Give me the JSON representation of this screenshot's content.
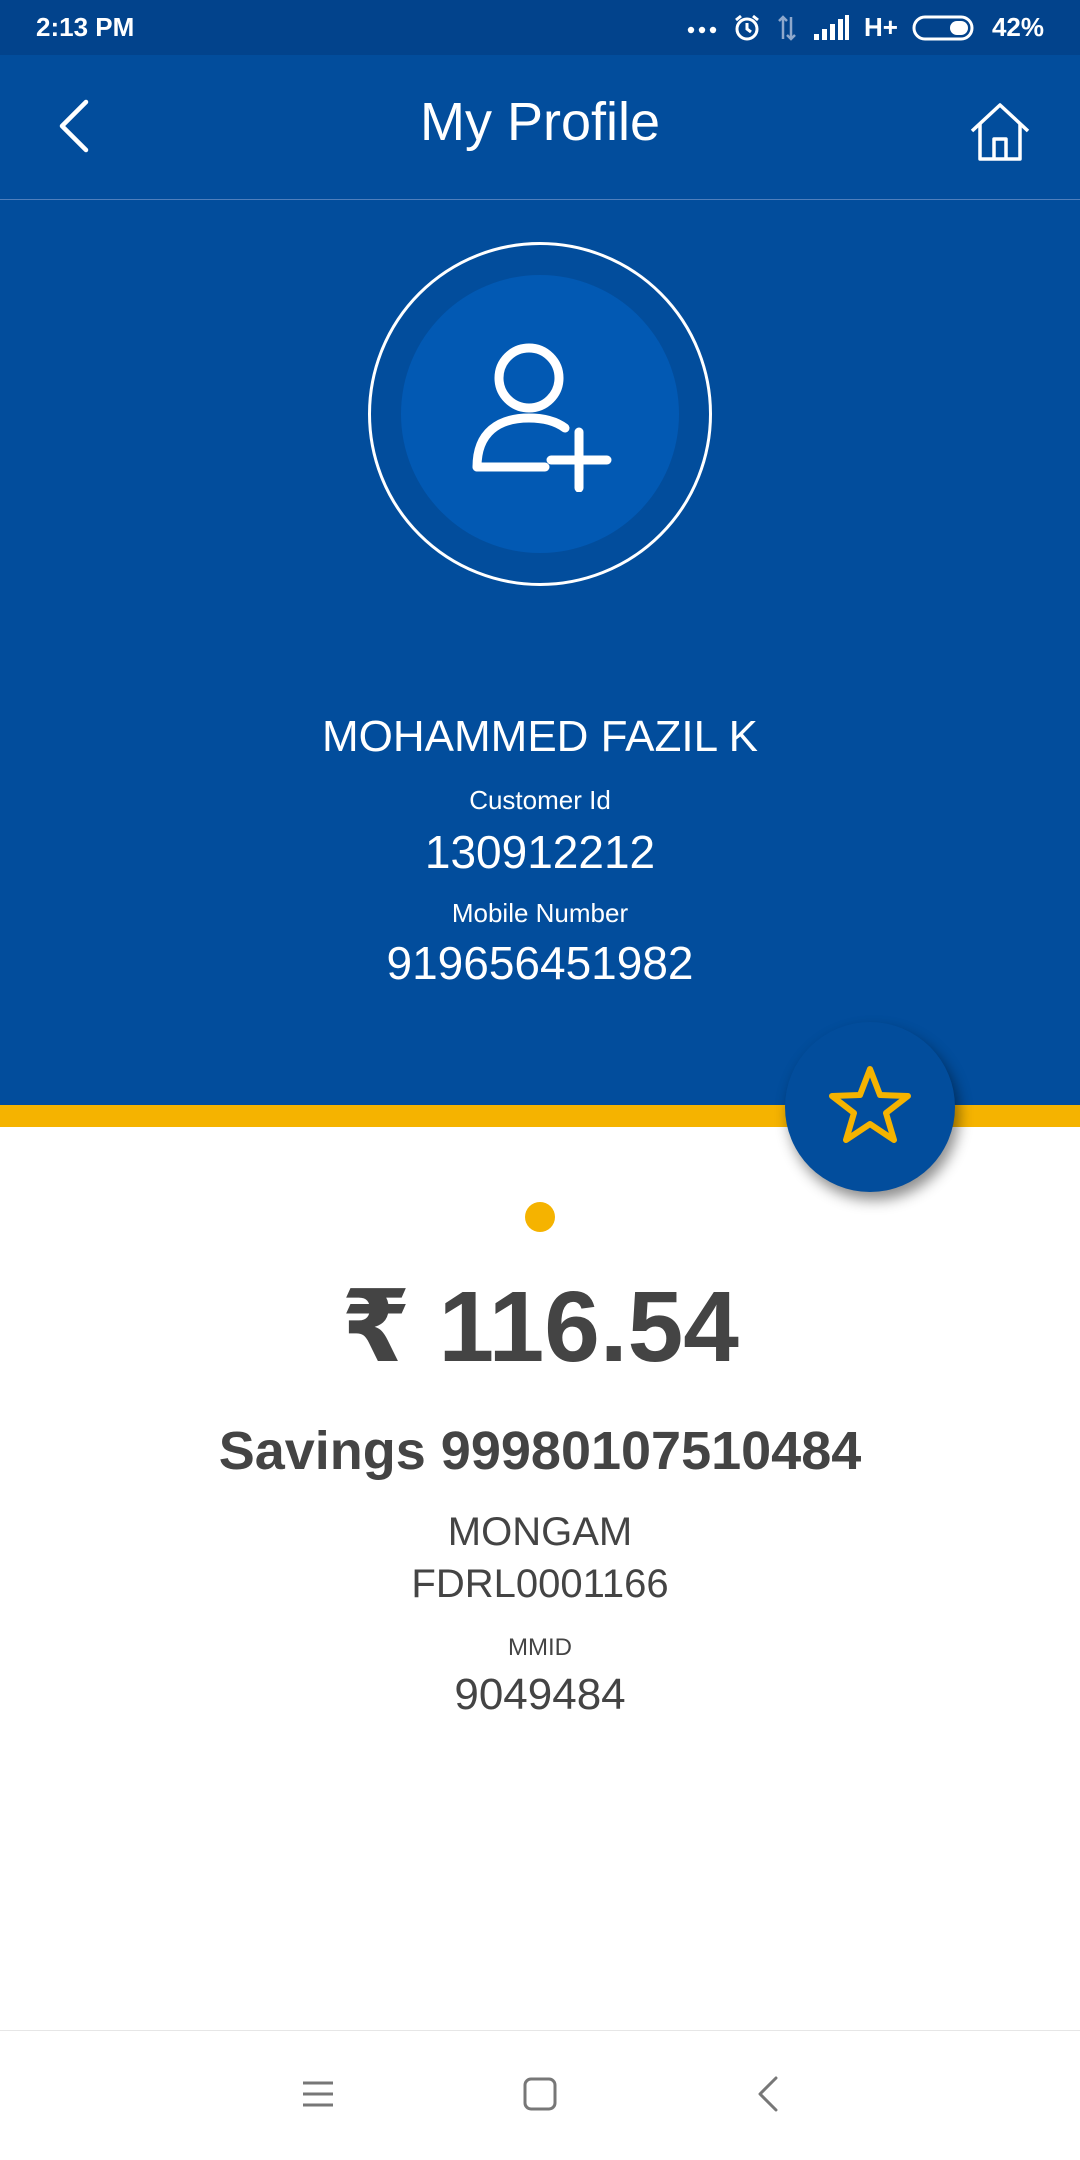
{
  "status_bar": {
    "time": "2:13 PM",
    "network": "H+",
    "battery": "42%"
  },
  "app_bar": {
    "title": "My Profile",
    "back_icon": "chevron-left-icon",
    "home_icon": "home-icon"
  },
  "profile": {
    "avatar_icon": "add-user-icon",
    "name": "MOHAMMED FAZIL K",
    "customer_id_label": "Customer Id",
    "customer_id": "130912212",
    "mobile_label": "Mobile Number",
    "mobile_number": "919656451982",
    "favorite_icon": "star-icon"
  },
  "account": {
    "balance": "₹ 116.54",
    "account_type": "Savings 99980107510484",
    "branch": "MONGAM",
    "ifsc": "FDRL0001166",
    "mmid_label": "MMID",
    "mmid": "9049484"
  },
  "nav_bar": {
    "menu_icon": "menu-icon",
    "home_icon": "square-home-icon",
    "back_icon": "back-triangle-icon"
  },
  "colors": {
    "primary": "#024d9c",
    "status_bar": "#02438c",
    "accent": "#f5b300",
    "text_dark": "#444444"
  }
}
